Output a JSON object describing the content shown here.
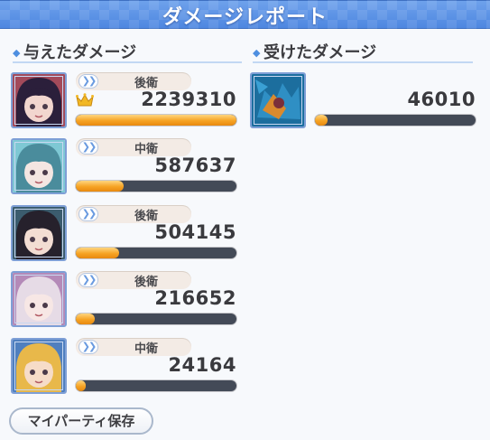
{
  "title": "ダメージレポート",
  "dealt_section": {
    "label": "与えたダメージ"
  },
  "received_section": {
    "label": "受けたダメージ"
  },
  "dealt": [
    {
      "position": "後衛",
      "damage": "2239310",
      "bar_fraction": 1.0,
      "top": true,
      "avatar_colors": [
        "#2b1f3b",
        "#f2d6cf",
        "#a34a5a"
      ]
    },
    {
      "position": "中衛",
      "damage": "587637",
      "bar_fraction": 0.3,
      "top": false,
      "avatar_colors": [
        "#4a8c9c",
        "#f4e6e2",
        "#7ec8d4"
      ]
    },
    {
      "position": "後衛",
      "damage": "504145",
      "bar_fraction": 0.27,
      "top": false,
      "avatar_colors": [
        "#26212c",
        "#f3ddd3",
        "#3b5c6e"
      ]
    },
    {
      "position": "後衛",
      "damage": "216652",
      "bar_fraction": 0.12,
      "top": false,
      "avatar_colors": [
        "#e6dbe6",
        "#f7e7e5",
        "#b48ab8"
      ]
    },
    {
      "position": "中衛",
      "damage": "24164",
      "bar_fraction": 0.05,
      "top": false,
      "avatar_colors": [
        "#e8b84a",
        "#f6dcc8",
        "#4f7fbf"
      ]
    }
  ],
  "received": [
    {
      "damage": "46010",
      "bar_fraction": 0.08,
      "avatar_colors": [
        "#1c6e9e",
        "#d98a2e",
        "#7a2f3a"
      ]
    }
  ],
  "save_button": {
    "label": "マイパーティ保存"
  },
  "colors": {
    "bar_fill": "#f6a324",
    "bar_track": "#434a57",
    "accent": "#4d86e0"
  },
  "icons": {
    "crown": "crown-icon",
    "chevron": "double-chevron-icon",
    "diamond": "diamond-icon"
  }
}
